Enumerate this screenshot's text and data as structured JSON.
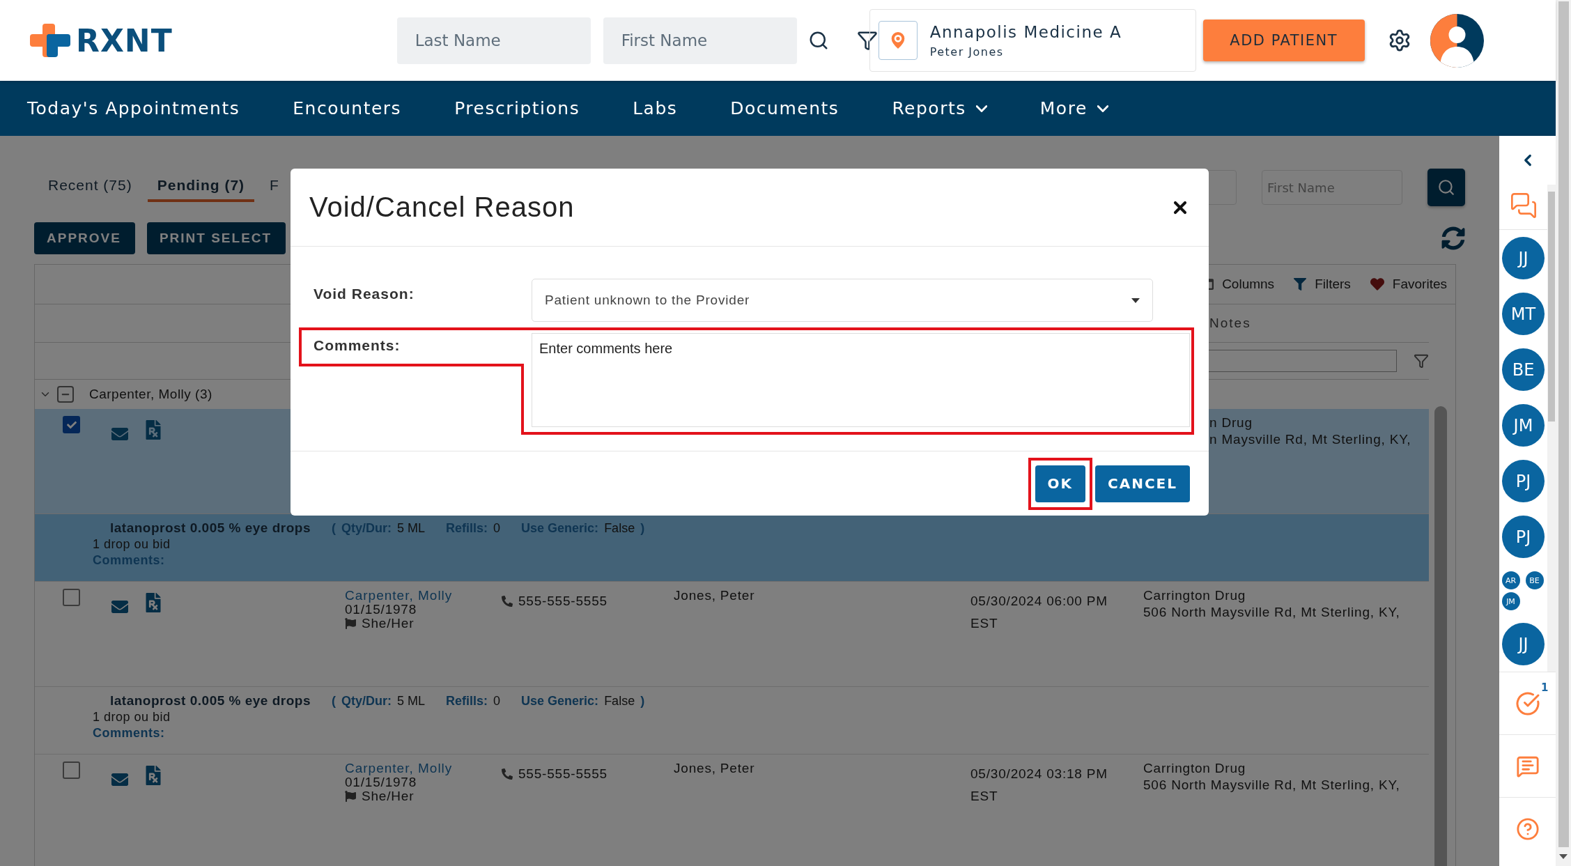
{
  "header": {
    "logo": "RXNT",
    "last_name_placeholder": "Last Name",
    "first_name_placeholder": "First Name",
    "location": {
      "name": "Annapolis Medicine A",
      "user": "Peter Jones"
    },
    "add_patient": "ADD PATIENT"
  },
  "nav": [
    {
      "label": "Today's Appointments",
      "dropdown": false
    },
    {
      "label": "Encounters",
      "dropdown": false
    },
    {
      "label": "Prescriptions",
      "dropdown": false
    },
    {
      "label": "Labs",
      "dropdown": false
    },
    {
      "label": "Documents",
      "dropdown": false
    },
    {
      "label": "Reports",
      "dropdown": true
    },
    {
      "label": "More",
      "dropdown": true
    }
  ],
  "tabs": [
    {
      "label": "Recent (75)",
      "selected": false
    },
    {
      "label": "Pending (7)",
      "selected": true
    },
    {
      "label": "F",
      "selected": false
    }
  ],
  "actions": [
    "APPROVE",
    "PRINT SELECT"
  ],
  "search": {
    "first_name_placeholder": "First Name"
  },
  "table": {
    "toolbar": [
      {
        "kind": "columns",
        "label": "Columns"
      },
      {
        "kind": "filters",
        "label": "Filters"
      },
      {
        "kind": "favorites",
        "label": "Favorites"
      }
    ],
    "column_header": "Notes",
    "group": {
      "name": "Carpenter, Molly (3)",
      "expanded": true
    },
    "rows": [
      {
        "selected": true,
        "checked": true,
        "pharmacy": "n Drug",
        "address": "n Maysville Rd, Mt Sterling, KY,",
        "drug": {
          "name": "latanoprost 0.005 % eye drops",
          "open": "(",
          "details": [
            {
              "label": "Qty/Dur:",
              "value": "5 ML"
            },
            {
              "label": "Refills:",
              "value": "0"
            },
            {
              "label": "Use Generic:",
              "value": "False"
            }
          ],
          "close": ")",
          "sig": "1 drop ou bid",
          "comments_label": "Comments:"
        }
      },
      {
        "selected": false,
        "checked": false,
        "patient": "Carpenter, Molly",
        "dob": "01/15/1978",
        "pronouns": "She/Her",
        "phone": "555-555-5555",
        "prescriber": "Jones, Peter",
        "date": "05/30/2024 06:00 PM",
        "timezone": "EST",
        "pharmacy": "Carrington Drug",
        "address": "506 North Maysville Rd, Mt Sterling, KY,",
        "drug": {
          "name": "latanoprost 0.005 % eye drops",
          "open": "(",
          "details": [
            {
              "label": "Qty/Dur:",
              "value": "5 ML"
            },
            {
              "label": "Refills:",
              "value": "0"
            },
            {
              "label": "Use Generic:",
              "value": "False"
            }
          ],
          "close": ")",
          "sig": "1 drop ou bid",
          "comments_label": "Comments:"
        }
      },
      {
        "selected": false,
        "checked": false,
        "patient": "Carpenter, Molly",
        "dob": "01/15/1978",
        "pronouns": "She/Her",
        "phone": "555-555-5555",
        "prescriber": "Jones, Peter",
        "date": "05/30/2024 03:18 PM",
        "timezone": "EST",
        "pharmacy": "Carrington Drug",
        "address": "506 North Maysville Rd, Mt Sterling, KY,"
      }
    ]
  },
  "sidebar": {
    "avatars": [
      {
        "initials": "JJ",
        "compact": false
      },
      {
        "initials": "MT",
        "compact": false
      },
      {
        "initials": "BE",
        "compact": false
      },
      {
        "initials": "JM",
        "compact": false
      },
      {
        "initials": "PJ",
        "compact": false
      },
      {
        "initials": "PJ",
        "compact": false
      },
      {
        "initials": "AR",
        "compact": true
      },
      {
        "initials": "BE",
        "compact": true
      },
      {
        "initials": "JM",
        "compact": true
      },
      {
        "initials": "JJ",
        "compact": false
      }
    ],
    "task_badge": "1"
  },
  "modal": {
    "title": "Void/Cancel Reason",
    "void_reason": {
      "label": "Void Reason:",
      "value": "Patient unknown to the Provider"
    },
    "comments": {
      "label": "Comments:",
      "placeholder": "Enter comments here",
      "highlighted": true
    },
    "buttons": [
      {
        "label": "OK",
        "highlighted": true
      },
      {
        "label": "CANCEL",
        "highlighted": false
      }
    ]
  }
}
